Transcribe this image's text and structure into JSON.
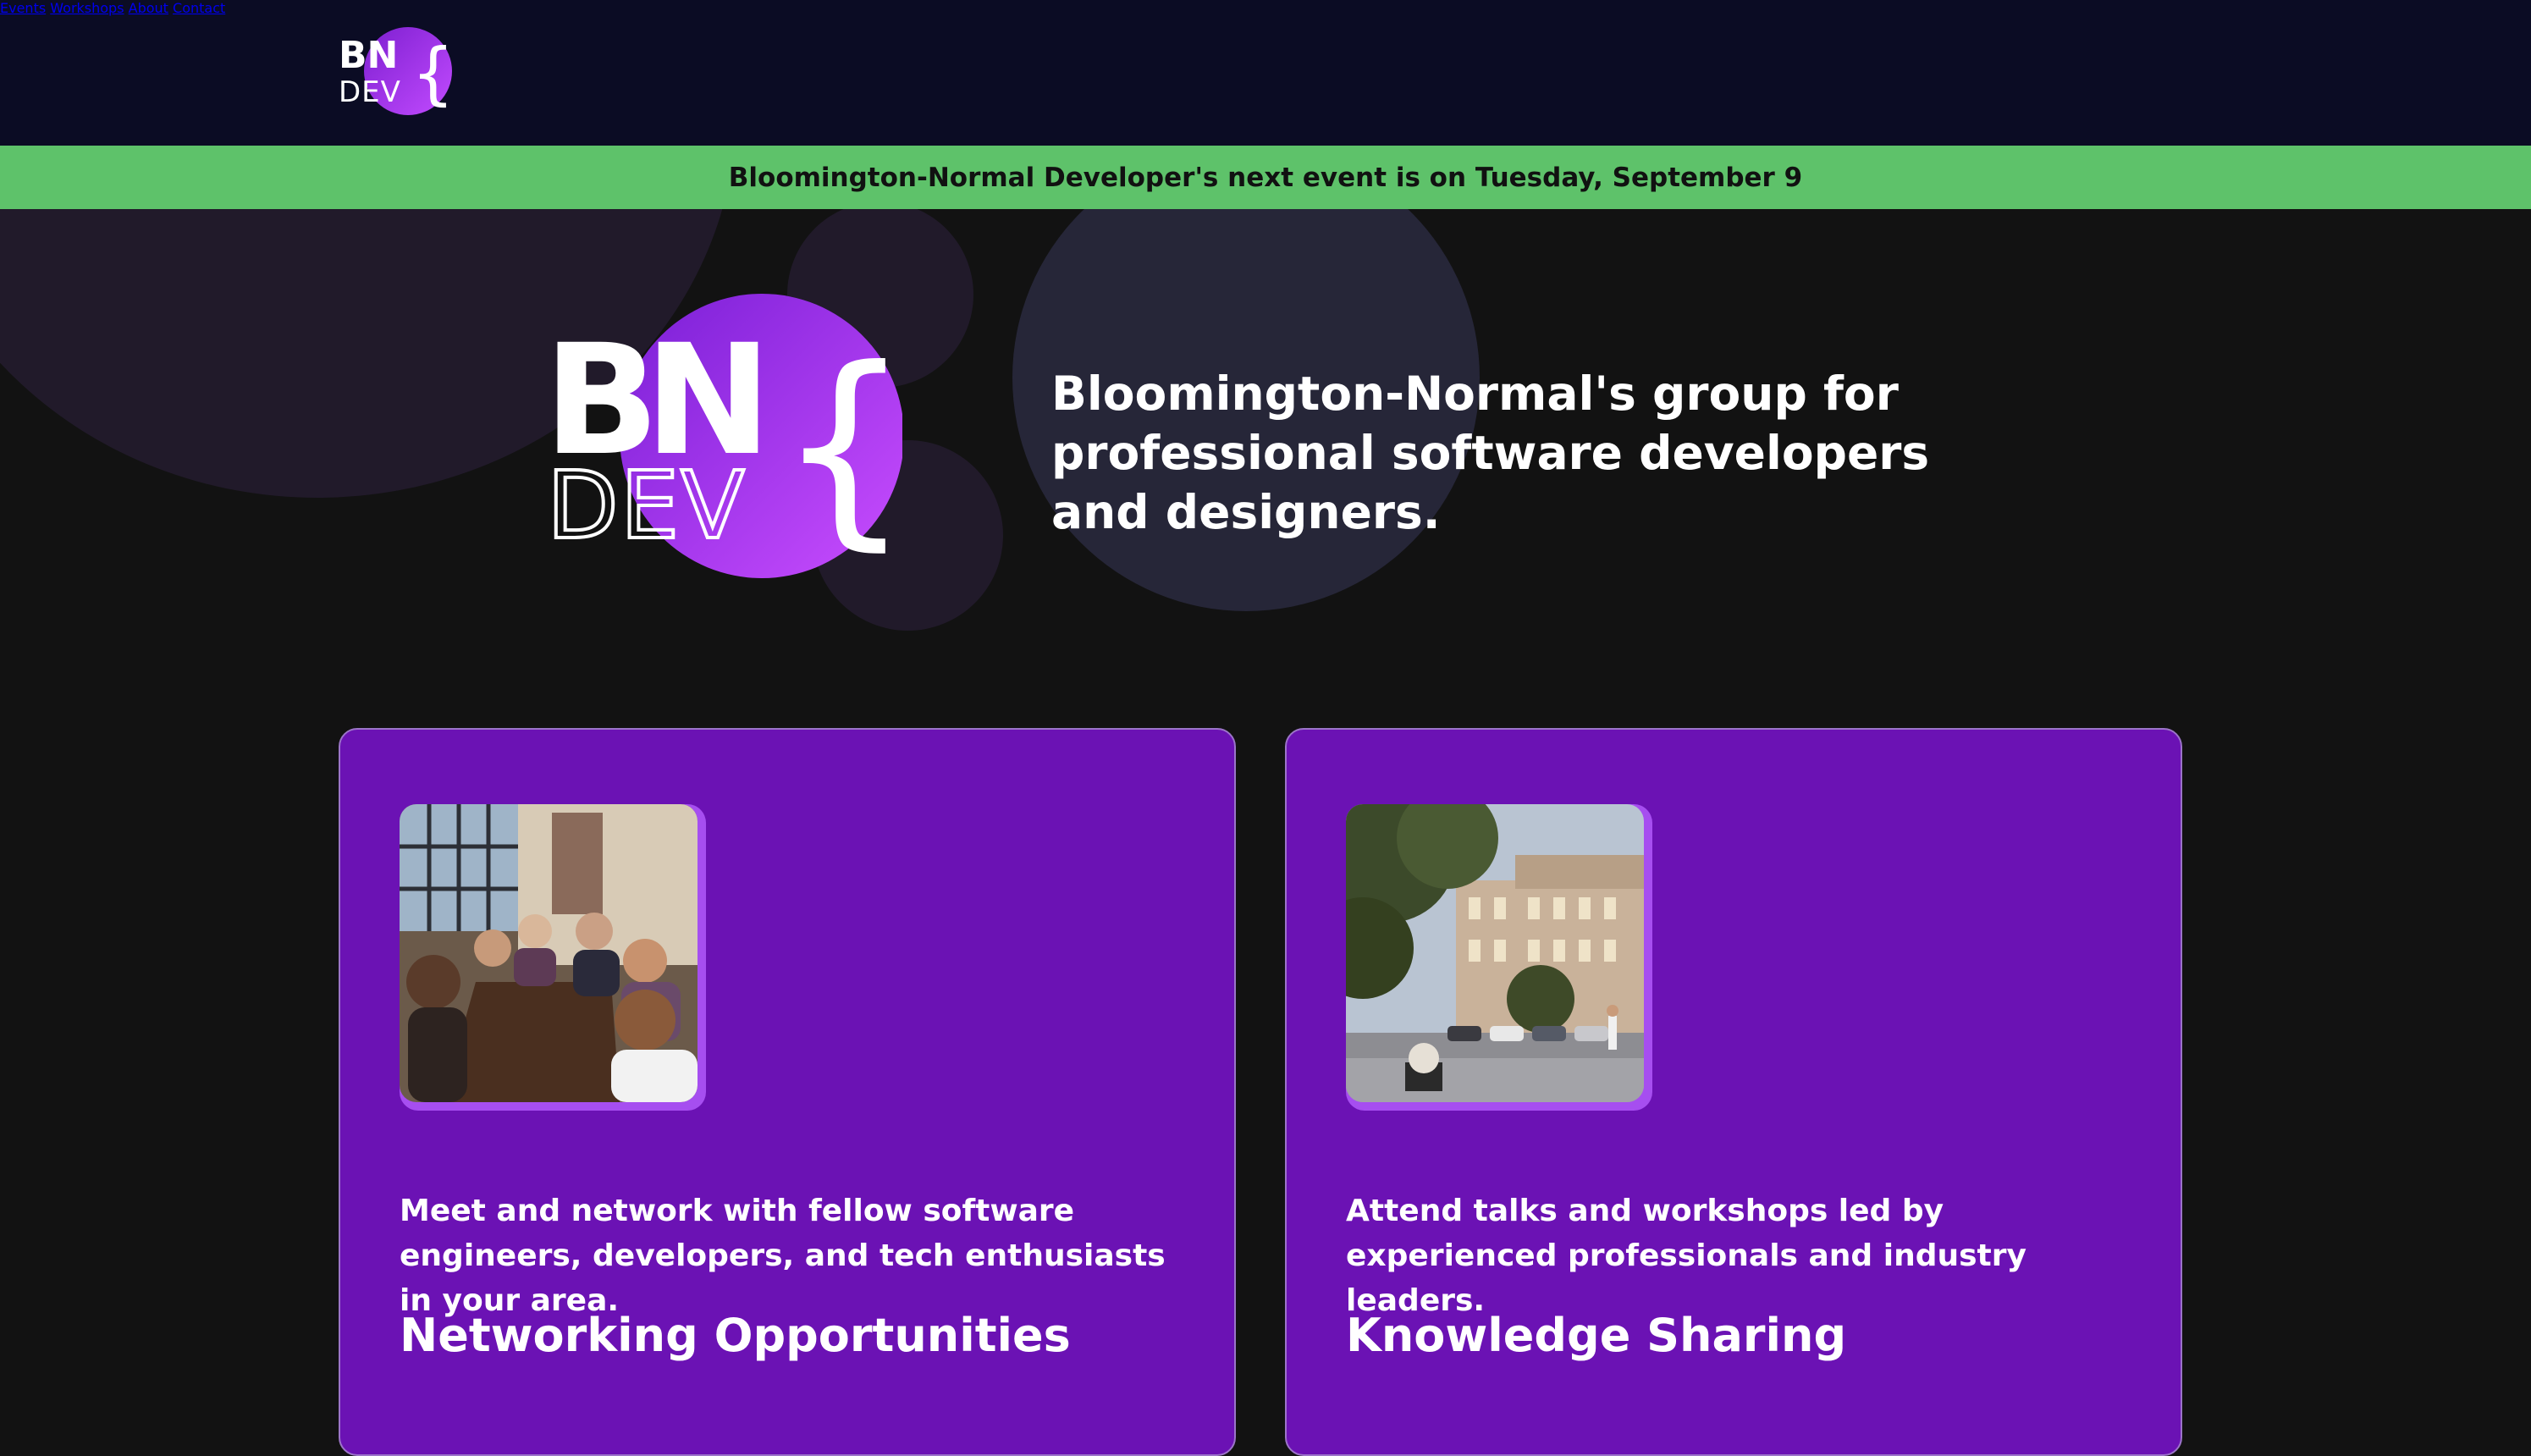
{
  "header": {
    "logo_alt": "BN DEV logo",
    "nav": [
      {
        "label": "Events"
      },
      {
        "label": "Workshops"
      },
      {
        "label": "About"
      },
      {
        "label": "Contact"
      }
    ]
  },
  "banner": {
    "text": "Bloomington-Normal Developer's next event is on Tuesday, September 9"
  },
  "hero": {
    "logo_top_text": "BN",
    "logo_bottom_text": "DEV",
    "logo_brace": "{",
    "tagline": "Bloomington-Normal's group for professional software developers and designers."
  },
  "cards": [
    {
      "description": "Meet and network with fellow software engineers, developers, and tech enthusiasts in your area.",
      "title": "Networking Opportunities"
    },
    {
      "description": "Attend talks and workshops led by experienced professionals and industry leaders.",
      "title": "Knowledge Sharing"
    }
  ],
  "colors": {
    "header_bg": "#0b0c24",
    "banner_bg": "#5ec26a",
    "page_bg": "#121212",
    "card_bg": "#6b12b4",
    "accent_purple": "#a64ef0"
  }
}
